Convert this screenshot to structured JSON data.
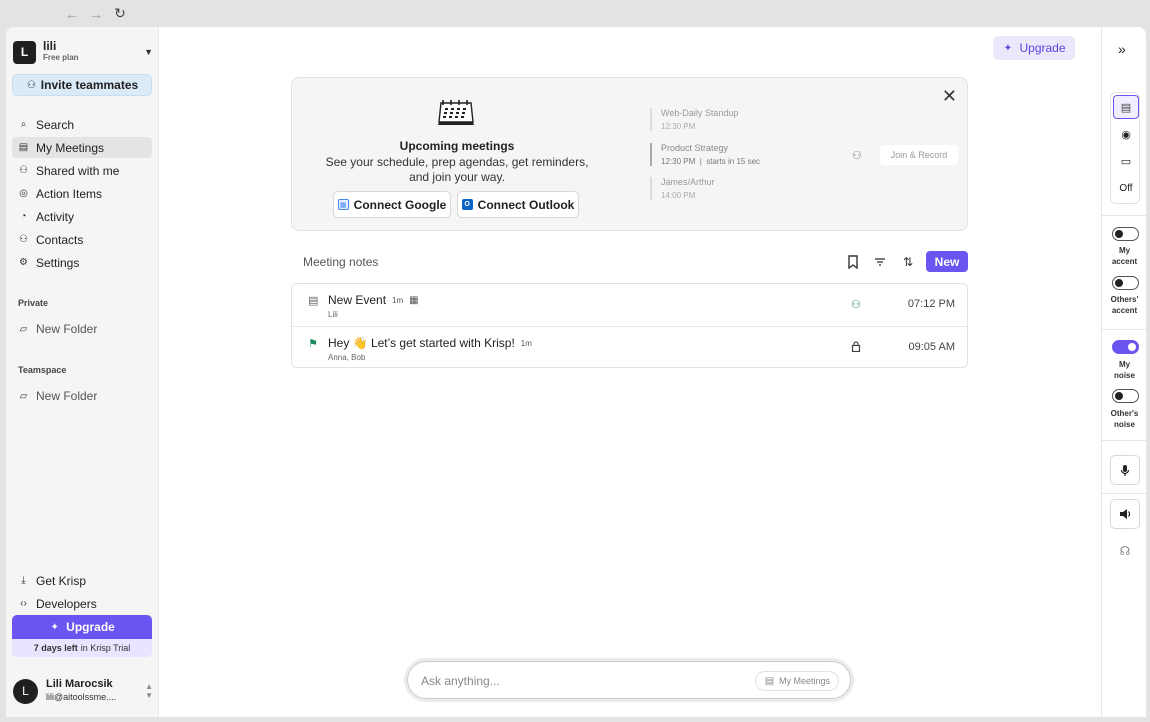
{
  "browser": {
    "back": "←",
    "forward": "→",
    "reload": "↻"
  },
  "workspace": {
    "avatar": "L",
    "name": "lili",
    "plan": "Free plan"
  },
  "invite_label": "Invite teammates",
  "nav": [
    {
      "label": "Search",
      "icon": "⌕"
    },
    {
      "label": "My Meetings",
      "icon": "▤"
    },
    {
      "label": "Shared with me",
      "icon": "⚇"
    },
    {
      "label": "Action Items",
      "icon": "◎"
    },
    {
      "label": "Activity",
      "icon": "◔"
    },
    {
      "label": "Contacts",
      "icon": "⚇"
    },
    {
      "label": "Settings",
      "icon": "⚙"
    }
  ],
  "sections": {
    "private": {
      "label": "Private",
      "folder": "New Folder"
    },
    "teamspace": {
      "label": "Teamspace",
      "folder": "New Folder"
    }
  },
  "bottom_nav": [
    {
      "label": "Get Krisp",
      "icon": "⤓"
    },
    {
      "label": "Developers",
      "icon": "‹›"
    }
  ],
  "upgrade_label": "Upgrade",
  "trial": {
    "days": "7 days left",
    "rest": "in Krisp Trial"
  },
  "user": {
    "avatar": "L",
    "name": "Lili Marocsik",
    "email": "lili@aitoolssme...."
  },
  "banner": {
    "title": "Upcoming meetings",
    "desc_line1": "See your schedule, prep agendas, get reminders,",
    "desc_line2": "and join your way.",
    "connect_google": "Connect Google",
    "connect_outlook": "Connect Outlook",
    "meetings": [
      {
        "title": "Web-Daily Standup",
        "time": "12:30 PM",
        "extra": ""
      },
      {
        "title": "Product Strategy",
        "time": "12:30 PM",
        "extra": "starts in 15 sec"
      },
      {
        "title": "James/Arthur",
        "time": "14:00 PM",
        "extra": ""
      }
    ],
    "join_label": "Join & Record"
  },
  "notes": {
    "label": "Meeting notes",
    "new_label": "New",
    "rows": [
      {
        "title": "New Event",
        "duration": "1m",
        "people": "Lili",
        "time": "07:12 PM"
      },
      {
        "title": "Hey 👋 Let’s get started with Krisp!",
        "duration": "1m",
        "people": "Anna, Bob",
        "time": "09:05 AM"
      }
    ]
  },
  "ask": {
    "placeholder": "Ask anything...",
    "scope": "My Meetings"
  },
  "right_panel": {
    "off_label": "Off",
    "toggles": [
      {
        "line1": "My",
        "line2": "accent",
        "on": false
      },
      {
        "line1": "Others'",
        "line2": "accent",
        "on": false
      },
      {
        "line1": "My",
        "line2": "noise",
        "on": true
      },
      {
        "line1": "Other's",
        "line2": "noise",
        "on": false
      }
    ]
  },
  "colors": {
    "accent": "#6a55f0",
    "sidebar_bg": "#f5f5f5",
    "banner_bg": "#f5f5f5"
  }
}
